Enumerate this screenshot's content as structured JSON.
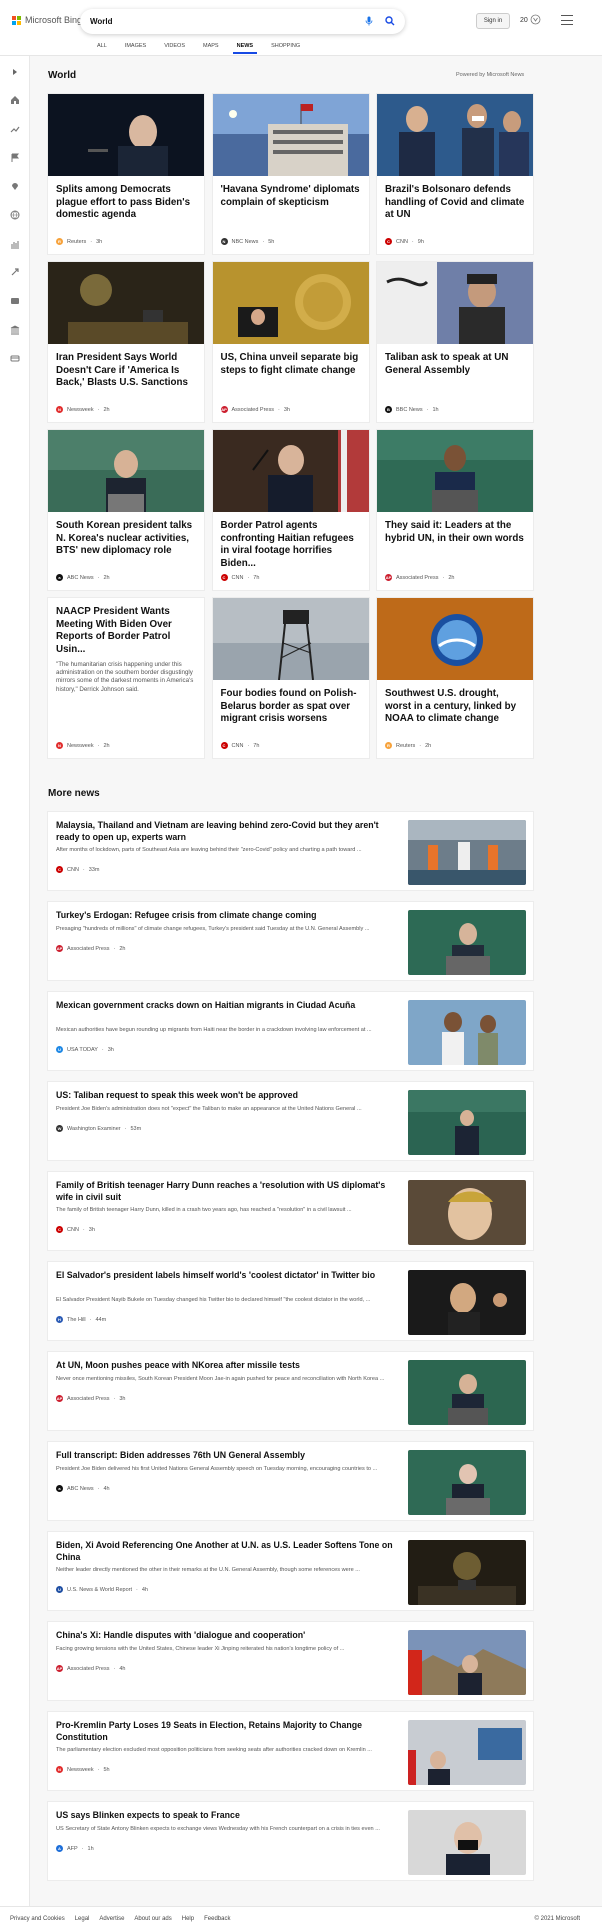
{
  "header": {
    "brand": "Microsoft Bing",
    "search_value": "World",
    "signin": "Sign in",
    "points": "20",
    "tabs": [
      "ALL",
      "IMAGES",
      "VIDEOS",
      "MAPS",
      "NEWS",
      "SHOPPING"
    ],
    "active_tab": "NEWS"
  },
  "leftbar": {
    "icons": [
      "expand-icon",
      "home-icon",
      "trending-icon",
      "flag-icon",
      "location-icon",
      "globe-icon",
      "business-icon",
      "science-icon",
      "entertainment-icon",
      "politics-icon",
      "money-icon"
    ]
  },
  "world": {
    "title": "World",
    "powered": "Powered by Microsoft News",
    "cards": [
      {
        "title": "Splits among Democrats plague effort to pass Biden's domestic agenda",
        "source": "Reuters",
        "time": "3h",
        "src_color": "#f7a23b",
        "src_letter": "R"
      },
      {
        "title": "'Havana Syndrome' diplomats complain of skepticism",
        "source": "NBC News",
        "time": "5h",
        "src_color": "#333333",
        "src_letter": "N"
      },
      {
        "title": "Brazil's Bolsonaro defends handling of Covid and climate at UN",
        "source": "CNN",
        "time": "9h",
        "src_color": "#cc0000",
        "src_letter": "C"
      },
      {
        "title": "Iran President Says World Doesn't Care if 'America Is Back,' Blasts U.S. Sanctions",
        "source": "Newsweek",
        "time": "2h",
        "src_color": "#e12d2d",
        "src_letter": "N"
      },
      {
        "title": "US, China unveil separate big steps to fight climate change",
        "source": "Associated Press",
        "time": "3h",
        "src_color": "#cc1f2f",
        "src_letter": "AP"
      },
      {
        "title": "Taliban ask to speak at UN General Assembly",
        "source": "BBC News",
        "time": "1h",
        "src_color": "#111111",
        "src_letter": "B"
      },
      {
        "title": "South Korean president talks N. Korea's nuclear activities, BTS' new diplomacy role",
        "source": "ABC News",
        "time": "2h",
        "src_color": "#111111",
        "src_letter": "a"
      },
      {
        "title": "Border Patrol agents confronting Haitian refugees in viral footage horrifies Biden...",
        "source": "CNN",
        "time": "7h",
        "src_color": "#cc0000",
        "src_letter": "C"
      },
      {
        "title": "They said it: Leaders at the hybrid UN, in their own words",
        "source": "Associated Press",
        "time": "2h",
        "src_color": "#cc1f2f",
        "src_letter": "AP"
      },
      {
        "title": "NAACP President Wants Meeting With Biden Over Reports of Border Patrol Usin...",
        "snippet": "\"The humanitarian crisis happening under this administration on the southern border disgustingly mirrors some of the darkest moments in America's history,\" Derrick Johnson said.",
        "source": "Newsweek",
        "time": "2h",
        "src_color": "#e12d2d",
        "src_letter": "N"
      },
      {
        "title": "Four bodies found on Polish-Belarus border as spat over migrant crisis worsens",
        "source": "CNN",
        "time": "7h",
        "src_color": "#cc0000",
        "src_letter": "C"
      },
      {
        "title": "Southwest U.S. drought, worst in a century, linked by NOAA to climate change",
        "source": "Reuters",
        "time": "2h",
        "src_color": "#f7a23b",
        "src_letter": "R"
      }
    ]
  },
  "more_news": {
    "title": "More news",
    "items": [
      {
        "title": "Malaysia, Thailand and Vietnam are leaving behind zero-Covid but they aren't ready to open up, experts warn",
        "desc": "After months of lockdown, parts of Southeast Asia are leaving behind their \"zero-Covid\" policy and charting a path toward ...",
        "source": "CNN",
        "time": "33m",
        "src_color": "#cc0000",
        "src_letter": "C"
      },
      {
        "title": "Turkey's Erdogan: Refugee crisis from climate change coming",
        "desc": "Presaging \"hundreds of millions\" of climate change refugees, Turkey's president said Tuesday at the U.N. General Assembly ...",
        "source": "Associated Press",
        "time": "2h",
        "src_color": "#cc1f2f",
        "src_letter": "AP"
      },
      {
        "title": "Mexican government cracks down on Haitian migrants in Ciudad Acuña",
        "desc": "Mexican authorities have begun rounding up migrants from Haiti near the border in a crackdown involving law enforcement at ...",
        "source": "USA TODAY",
        "time": "3h",
        "src_color": "#1e88e5",
        "src_letter": "U"
      },
      {
        "title": "US: Taliban request to speak this week won't be approved",
        "desc": "President Joe Biden's administration does not \"expect\" the Taliban to make an appearance at the United Nations General ...",
        "source": "Washington Examiner",
        "time": "53m",
        "src_color": "#333333",
        "src_letter": "W"
      },
      {
        "title": "Family of British teenager Harry Dunn reaches a 'resolution with US diplomat's wife in civil suit",
        "desc": "The family of British teenager Harry Dunn, killed in a crash two years ago, has reached a \"resolution\" in a civil lawsuit ...",
        "source": "CNN",
        "time": "3h",
        "src_color": "#cc0000",
        "src_letter": "C"
      },
      {
        "title": "El Salvador's president labels himself world's 'coolest dictator' in Twitter bio",
        "desc": "El Salvador President Nayib Bukele on Tuesday changed his Twitter bio to declared himself \"the coolest dictator in the world, ...",
        "source": "The Hill",
        "time": "44m",
        "src_color": "#2b5bb5",
        "src_letter": "H"
      },
      {
        "title": "At UN, Moon pushes peace with NKorea after missile tests",
        "desc": "Never once mentioning missiles, South Korean President Moon Jae-in again pushed for peace and reconciliation with North Korea ...",
        "source": "Associated Press",
        "time": "3h",
        "src_color": "#cc1f2f",
        "src_letter": "AP"
      },
      {
        "title": "Full transcript: Biden addresses 76th UN General Assembly",
        "desc": "President Joe Biden delivered his first United Nations General Assembly speech on Tuesday morning, encouraging countries to ...",
        "source": "ABC News",
        "time": "4h",
        "src_color": "#111111",
        "src_letter": "a"
      },
      {
        "title": "Biden, Xi Avoid Referencing One Another at U.N. as U.S. Leader Softens Tone on China",
        "desc": "Neither leader directly mentioned the other in their remarks at the U.N. General Assembly, though some references were ...",
        "source": "U.S. News & World Report",
        "time": "4h",
        "src_color": "#1f4fa3",
        "src_letter": "U"
      },
      {
        "title": "China's Xi: Handle disputes with 'dialogue and cooperation'",
        "desc": "Facing growing tensions with the United States, Chinese leader Xi Jinping reiterated his nation's longtime policy of ...",
        "source": "Associated Press",
        "time": "4h",
        "src_color": "#cc1f2f",
        "src_letter": "AP"
      },
      {
        "title": "Pro-Kremlin Party Loses 19 Seats in Election, Retains Majority to Change Constitution",
        "desc": "The parliamentary election excluded most opposition politicians from seeking seats after authorities cracked down on Kremlin ...",
        "source": "Newsweek",
        "time": "5h",
        "src_color": "#e12d2d",
        "src_letter": "N"
      },
      {
        "title": "US says Blinken expects to speak to France",
        "desc": "US Secretary of State Antony Blinken expects to exchange views Wednesday with his French counterpart on a crisis in ties even ...",
        "source": "AFP",
        "time": "1h",
        "src_color": "#1e6fd9",
        "src_letter": "A"
      }
    ]
  },
  "footer": {
    "links": [
      "Privacy and Cookies",
      "Legal",
      "Advertise",
      "About our ads",
      "Help",
      "Feedback"
    ],
    "copyright": "© 2021 Microsoft"
  }
}
